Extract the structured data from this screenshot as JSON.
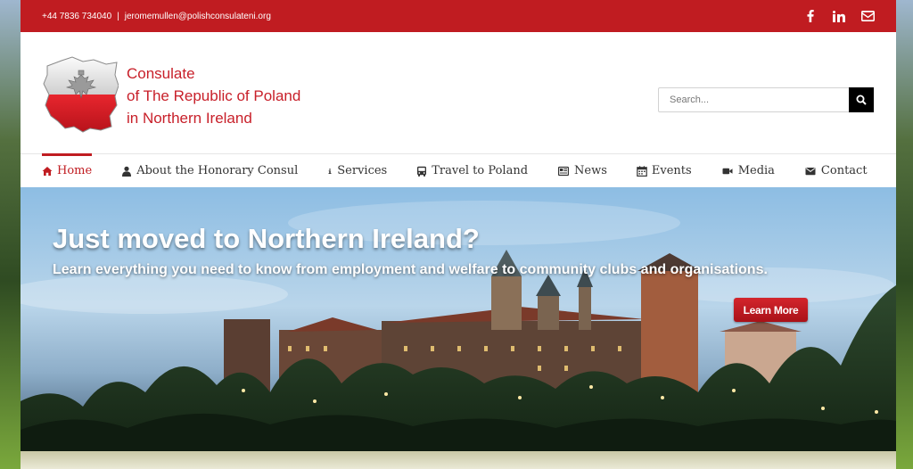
{
  "topbar": {
    "phone": "+44 7836 734040",
    "separator": "|",
    "email": "jeromemullen@polishconsulateni.org",
    "socials": [
      "facebook-icon",
      "linkedin-icon",
      "email-icon"
    ]
  },
  "header": {
    "title_line1": "Consulate",
    "title_line2": "of The Republic of Poland",
    "title_line3": "in Northern Ireland",
    "search_placeholder": "Search..."
  },
  "nav": {
    "items": [
      {
        "label": "Home",
        "icon": "home-icon"
      },
      {
        "label": "About the Honorary Consul",
        "icon": "user-icon"
      },
      {
        "label": "Services",
        "icon": "info-icon"
      },
      {
        "label": "Travel to Poland",
        "icon": "bus-icon"
      },
      {
        "label": "News",
        "icon": "newspaper-icon"
      },
      {
        "label": "Events",
        "icon": "calendar-icon"
      },
      {
        "label": "Media",
        "icon": "video-camera-icon"
      },
      {
        "label": "Contact",
        "icon": "envelope-icon"
      }
    ]
  },
  "hero": {
    "title": "Just moved to Northern Ireland?",
    "subtitle": "Learn everything you need to know from employment and welfare to community clubs and organisations.",
    "button_label": "Learn More"
  },
  "colors": {
    "brand_red": "#c01c21",
    "title_red": "#c8202a"
  }
}
